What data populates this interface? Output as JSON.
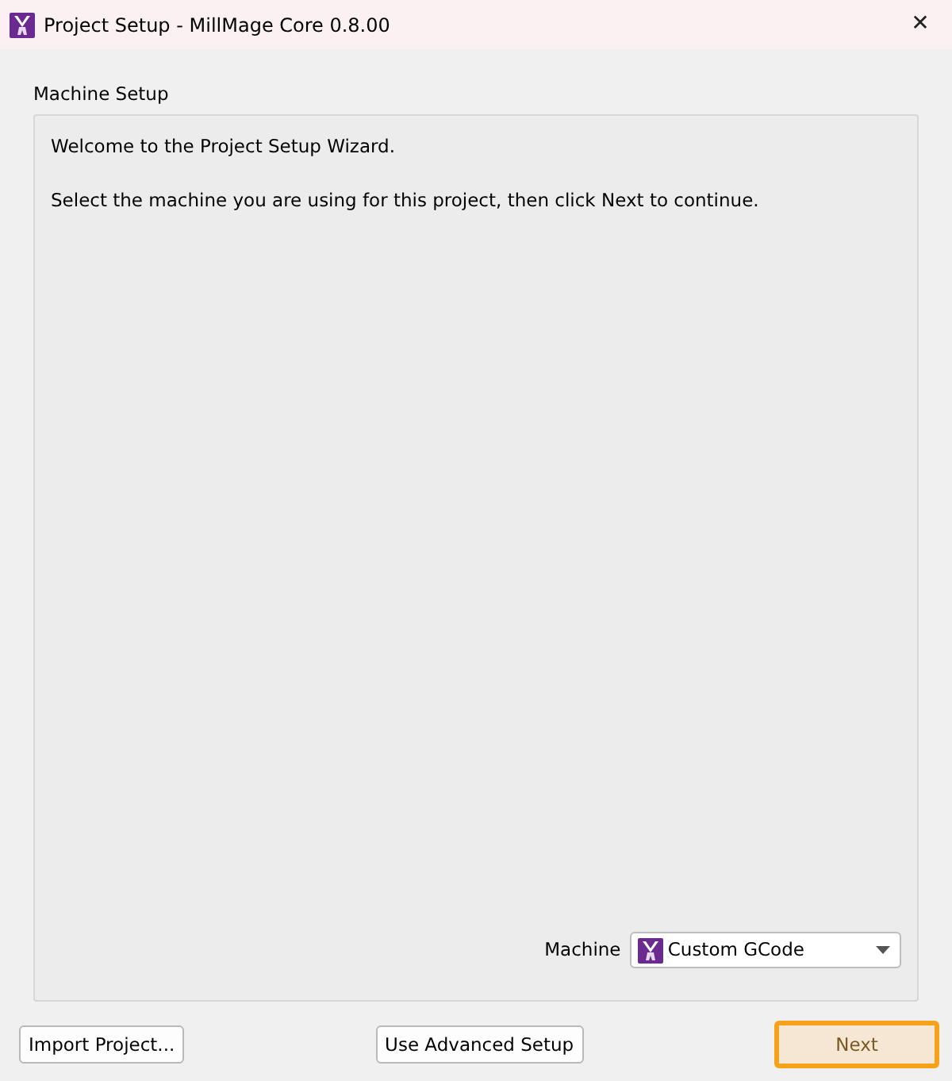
{
  "window": {
    "title": "Project Setup - MillMage Core 0.8.00",
    "close": "✕"
  },
  "group": {
    "title": "Machine Setup",
    "paragraphs": [
      "Welcome to the Project Setup Wizard.",
      "Select the machine you are using for this project, then click Next to continue."
    ],
    "machine": {
      "label": "Machine",
      "value": "Custom GCode"
    }
  },
  "buttons": [
    {
      "label": "Import Project...",
      "focused": false
    },
    {
      "label": "Use Advanced Setup",
      "focused": false
    },
    {
      "label": "Next",
      "focused": true
    }
  ]
}
